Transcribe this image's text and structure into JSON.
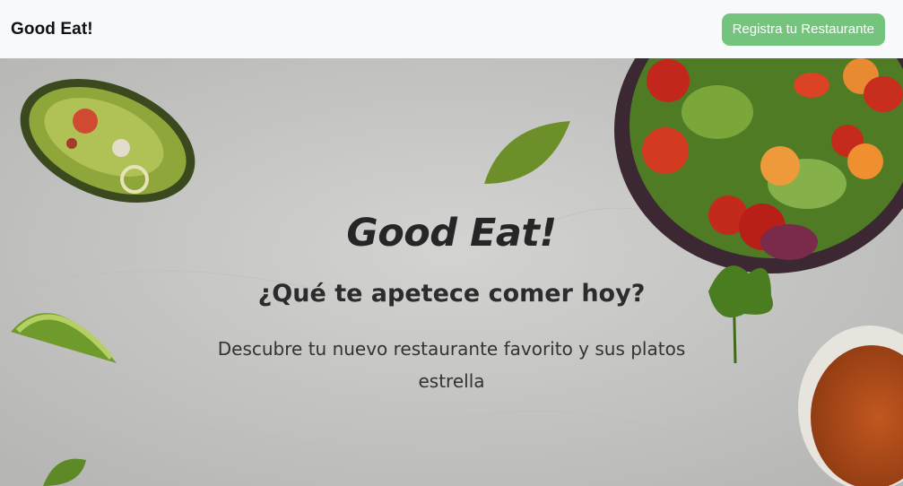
{
  "navbar": {
    "brand": "Good Eat!",
    "cta_label": "Registra tu Restaurante"
  },
  "hero": {
    "title": "Good Eat!",
    "subtitle": "¿Qué te apetece comer hoy?",
    "description": "Descubre tu nuevo restaurante favorito y sus platos estrella",
    "background_icon": "food-table-photo"
  },
  "colors": {
    "navbar_bg": "#f8f9fa",
    "cta_bg": "#74c47e",
    "hero_bg": "#c8c8c6"
  }
}
